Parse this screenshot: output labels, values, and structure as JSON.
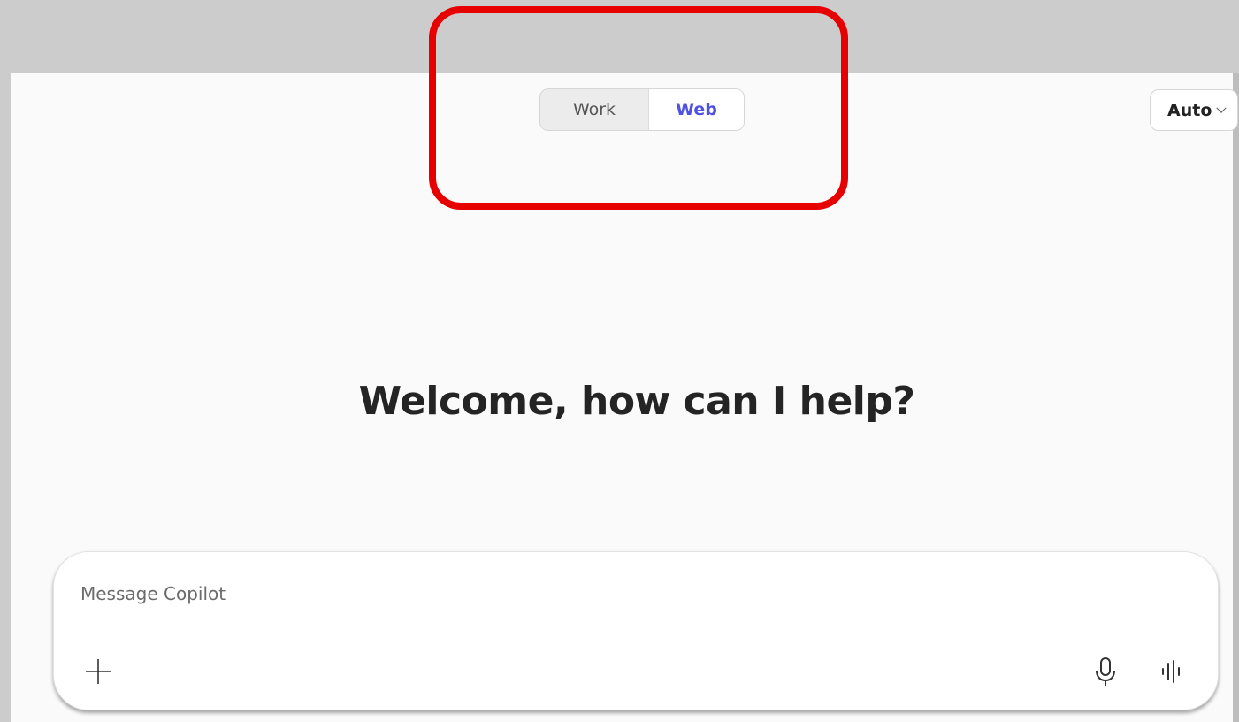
{
  "mode_toggle": {
    "options": [
      {
        "label": "Work",
        "selected": false
      },
      {
        "label": "Web",
        "selected": true
      }
    ],
    "accent_color": "#4f52e0"
  },
  "model_select": {
    "value": "Auto",
    "icon": "chevron-down-icon"
  },
  "main": {
    "welcome_heading": "Welcome, how can I help?"
  },
  "composer": {
    "placeholder": "Message Copilot",
    "value": "",
    "icons": [
      "plus-icon",
      "microphone-icon",
      "voice-waveform-icon"
    ]
  },
  "annotation": {
    "highlight_color": "#e60000"
  }
}
